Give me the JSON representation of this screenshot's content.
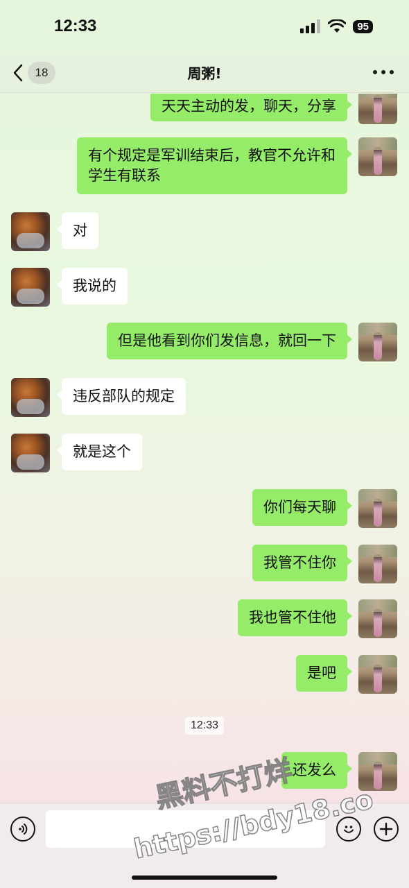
{
  "status_bar": {
    "time": "12:33",
    "battery": "95"
  },
  "nav": {
    "back_count": "18",
    "title": "周粥!"
  },
  "messages": [
    {
      "text": "天天主动的发，聊天，分享"
    },
    {
      "text": "有个规定是军训结束后，教官不允许和学生有联系"
    },
    {
      "text": "对"
    },
    {
      "text": "我说的"
    },
    {
      "text": "但是他看到你们发信息，就回一下"
    },
    {
      "text": "违反部队的规定"
    },
    {
      "text": "就是这个"
    },
    {
      "text": "你们每天聊"
    },
    {
      "text": "我管不住你"
    },
    {
      "text": "我也管不住他"
    },
    {
      "text": "是吧"
    },
    {
      "text": "还发么"
    }
  ],
  "timestamp": "12:33",
  "input_bar": {
    "voice_icon": "voice-icon",
    "emoji_icon": "emoji-icon",
    "add_icon": "plus-icon",
    "placeholder": ""
  },
  "watermark": {
    "line1": "黑料不打烊",
    "line2": "https://bdy18.co"
  }
}
